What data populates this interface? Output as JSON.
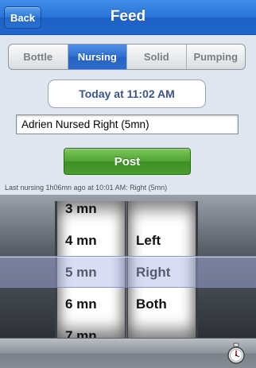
{
  "nav": {
    "back_label": "Back",
    "title": "Feed"
  },
  "segments": [
    {
      "label": "Bottle",
      "active": false
    },
    {
      "label": "Nursing",
      "active": true
    },
    {
      "label": "Solid",
      "active": false
    },
    {
      "label": "Pumping",
      "active": false
    }
  ],
  "date_button": {
    "label": "Today at 11:02 AM"
  },
  "entry": {
    "value": "Adrien Nursed Right (5mn)"
  },
  "post_button": {
    "label": "Post"
  },
  "status": {
    "text": "Last nursing 1h06mn ago at 10:01 AM: Right (5mn)"
  },
  "picker": {
    "duration": [
      "3 mn",
      "4 mn",
      "5 mn",
      "6 mn",
      "7 mn"
    ],
    "duration_selected": "5 mn",
    "side": [
      "Left",
      "Right",
      "Both"
    ],
    "side_selected": "Right"
  },
  "toolbar": {
    "icon": "stopwatch-icon"
  },
  "colors": {
    "nav_blue": "#2b74d8",
    "post_green": "#4fa333",
    "date_text": "#3c5486"
  }
}
